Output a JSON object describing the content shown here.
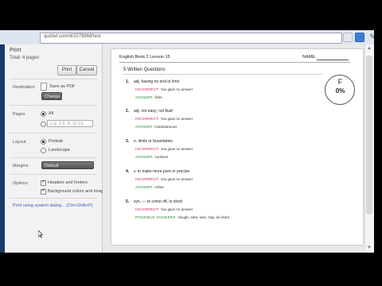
{
  "browser": {
    "url": "quizlet.com/4/2579868/test"
  },
  "print_panel": {
    "title": "Print",
    "total_label": "Total: 4 pages",
    "print_button": "Print",
    "cancel_button": "Cancel",
    "destination_label": "Destination",
    "destination_value": "Save as PDF",
    "change_button": "Change...",
    "pages_label": "Pages",
    "pages_all": "All",
    "pages_placeholder": "e.g. 1-5, 8, 11-13",
    "layout_label": "Layout",
    "layout_portrait": "Portrait",
    "layout_landscape": "Landscape",
    "margins_label": "Margins",
    "margins_value": "Default",
    "options_label": "Options",
    "option_headers": "Headers and footers",
    "option_background": "Background colors and images",
    "system_dialog_link": "Print using system dialog... (Ctrl+Shift+P)"
  },
  "document": {
    "header": "English Book 2 Lesson 15",
    "name_label": "NAME",
    "section_title": "5 Written Questions",
    "grade": "F",
    "percent": "0%",
    "questions": [
      {
        "num": "1.",
        "text": "adj. having no end or limit",
        "incorrect_tag": "INCORRECT:",
        "incorrect_msg": "You gave no answer",
        "answer_tag": "ANSWER:",
        "answer_value": "finite"
      },
      {
        "num": "2.",
        "text": "adj. not easy; not fluid",
        "incorrect_tag": "INCORRECT:",
        "incorrect_msg": "You gave no answer",
        "answer_tag": "ANSWER:",
        "answer_value": "instantaneous"
      },
      {
        "num": "3.",
        "text": "n. limits or boundaries",
        "incorrect_tag": "INCORRECT:",
        "incorrect_msg": "You gave no answer",
        "answer_tag": "ANSWER:",
        "answer_value": "confines"
      },
      {
        "num": "4.",
        "text": "v. to make more pure or precise",
        "incorrect_tag": "INCORRECT:",
        "incorrect_msg": "You gave no answer",
        "answer_tag": "ANSWER:",
        "answer_value": "refine"
      },
      {
        "num": "5.",
        "text": "syn. — to come off, to shed",
        "incorrect_tag": "INCORRECT:",
        "incorrect_msg": "You gave no answer",
        "answer_tag": "POSSIBLE ANSWERS:",
        "answer_value": "slough, slew, slue, slay, de-shed"
      }
    ]
  }
}
